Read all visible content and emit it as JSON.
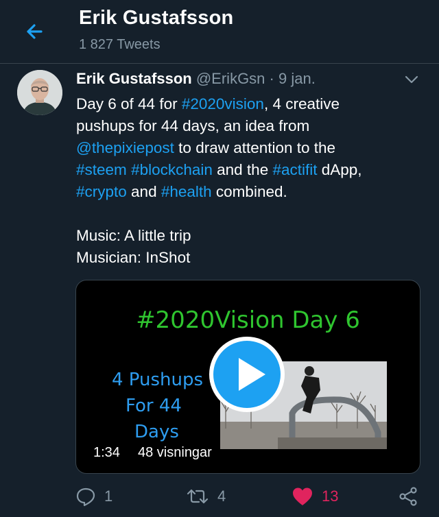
{
  "header": {
    "title": "Erik Gustafsson",
    "tweet_count": "1 827 Tweets"
  },
  "tweet": {
    "author_name": "Erik Gustafsson",
    "handle": "@ErikGsn",
    "separator": "·",
    "date": "9 jan.",
    "text": {
      "l1a": "Day 6 of 44 for ",
      "l1_tag": "#2020vision",
      "l1b": ", 4 creative",
      "l2": "pushups for 44 days, an idea from",
      "l3_mention": "@thepixiepost",
      "l3b": " to draw attention to the",
      "l4_tag1": "#steem",
      "l4_sp": " ",
      "l4_tag2": "#blockchain",
      "l4b": " and the ",
      "l4_tag3": "#actifit",
      "l4c": " dApp,",
      "l5_tag1": "#crypto",
      "l5b": " and ",
      "l5_tag2": "#health",
      "l5c": " combined.",
      "music": "Music: A little trip",
      "musician": "Musician: InShot"
    },
    "video": {
      "title": "#2020Vision Day 6",
      "line1": "4 Pushups",
      "line2": "For 44",
      "line3": "Days",
      "duration": "1:34",
      "views": "48 visningar"
    },
    "actions": {
      "replies": "1",
      "retweets": "4",
      "likes": "13"
    }
  },
  "colors": {
    "background": "#15202b",
    "accent": "#1da1f2",
    "muted": "#8899a6",
    "like": "#e0245e",
    "video_title": "#2fc52f"
  },
  "icons": [
    "back-arrow-icon",
    "chevron-down-icon",
    "play-icon",
    "reply-icon",
    "retweet-icon",
    "heart-icon",
    "share-icon"
  ]
}
